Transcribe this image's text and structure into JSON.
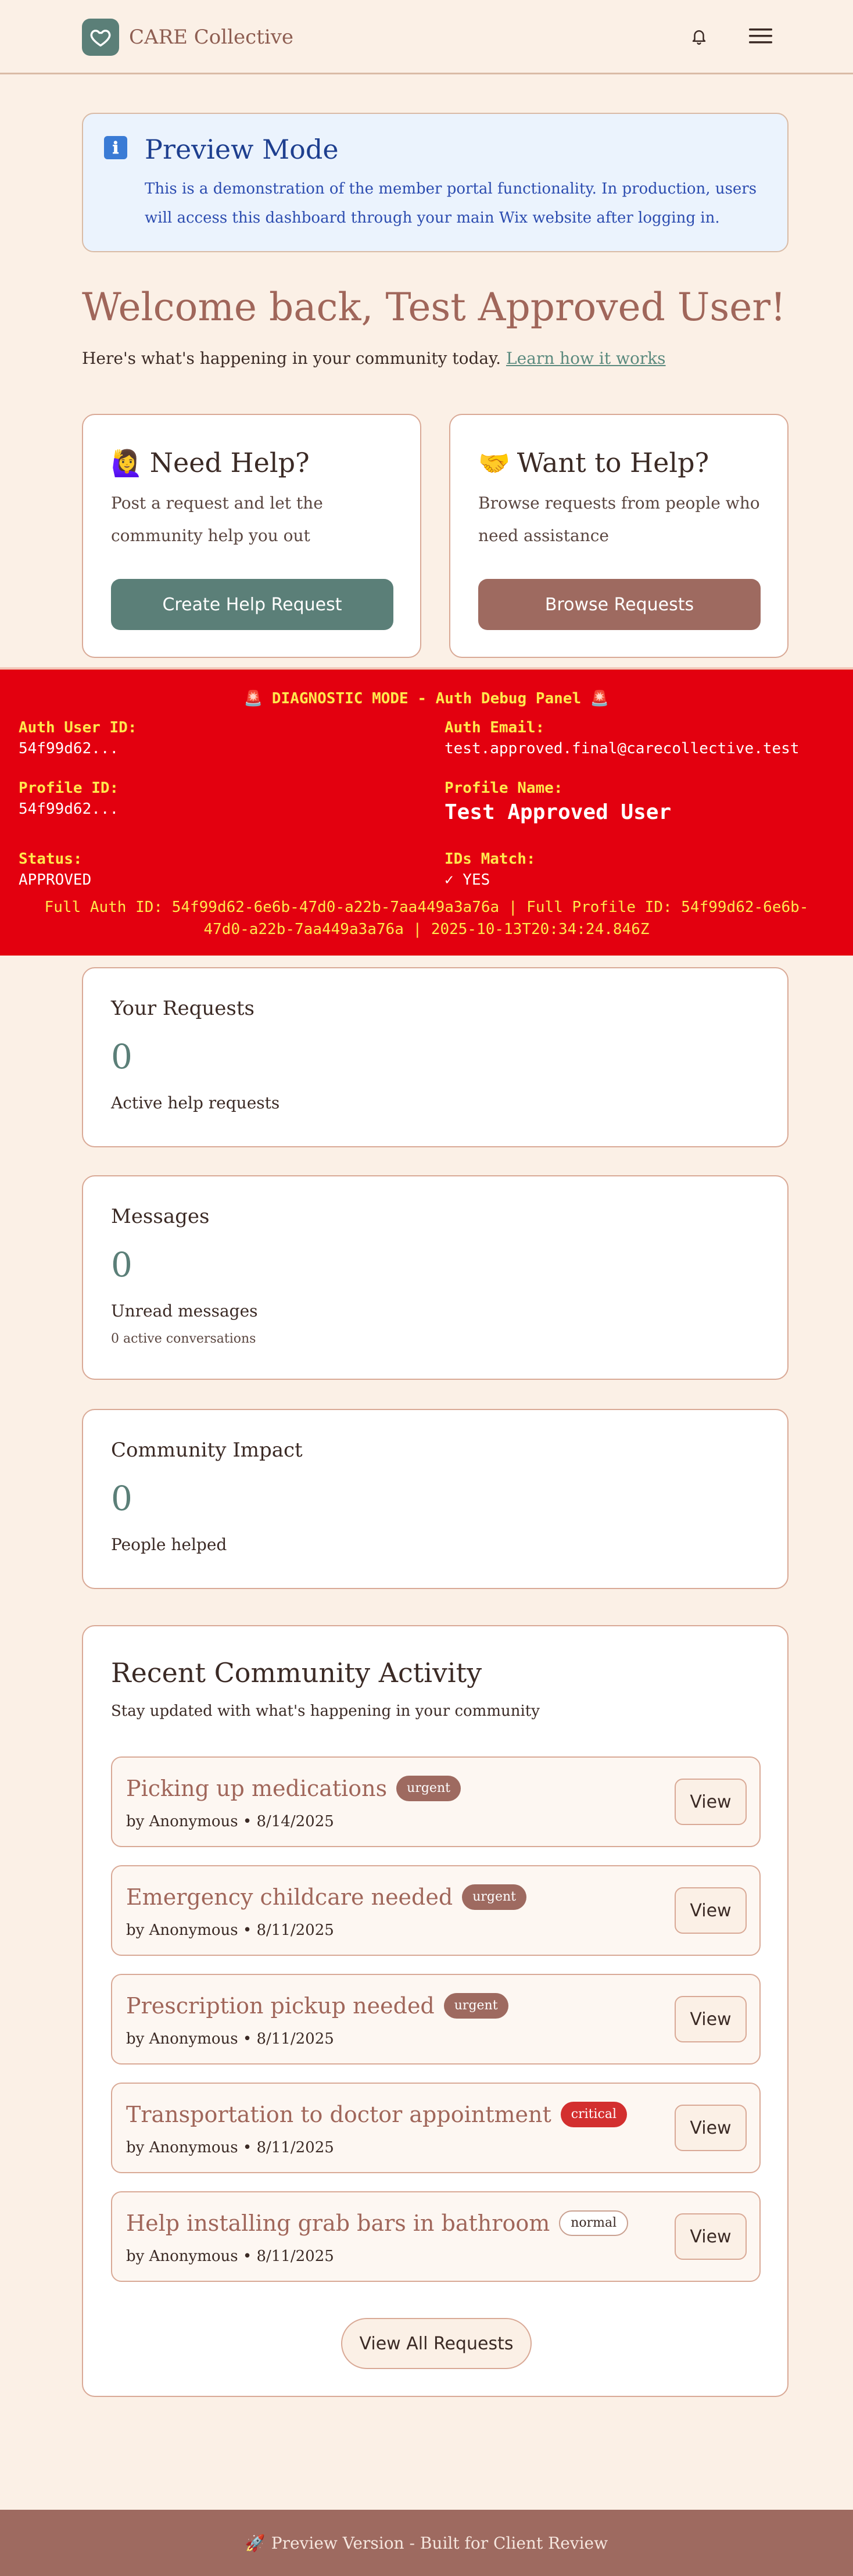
{
  "header": {
    "brand": "CARE Collective",
    "logo_icon": "heart-icon",
    "notifications_icon": "bell-icon",
    "menu_icon": "hamburger-menu-icon"
  },
  "preview": {
    "icon": "ℹ",
    "title": "Preview Mode",
    "text": "This is a demonstration of the member portal functionality. In production, users will access this dashboard through your main Wix website after logging in."
  },
  "welcome": {
    "title": "Welcome back, Test Approved User!",
    "subtitle": "Here's what's happening in your community today.",
    "link": "Learn how it works"
  },
  "need_help": {
    "emoji": "🙋‍♀️",
    "title": "Need Help?",
    "description": "Post a request and let the community help you out",
    "button": "Create Help Request"
  },
  "want_help": {
    "emoji": "🤝",
    "title": "Want to Help?",
    "description": "Browse requests from people who need assistance",
    "button": "Browse Requests"
  },
  "debug": {
    "title": "🚨 DIAGNOSTIC MODE - Auth Debug Panel 🚨",
    "auth_user_id_label": "Auth User ID:",
    "auth_user_id": "54f99d62...",
    "auth_email_label": "Auth Email:",
    "auth_email": "test.approved.final@carecollective.test",
    "profile_id_label": "Profile ID:",
    "profile_id": "54f99d62...",
    "profile_name_label": "Profile Name:",
    "profile_name": "Test Approved User",
    "status_label": "Status:",
    "status": "APPROVED",
    "ids_match_label": "IDs Match:",
    "ids_match": "✓ YES",
    "footer": "Full Auth ID: 54f99d62-6e6b-47d0-a22b-7aa449a3a76a | Full Profile ID: 54f99d62-6e6b-47d0-a22b-7aa449a3a76a | 2025-10-13T20:34:24.846Z"
  },
  "stats": {
    "requests": {
      "title": "Your Requests",
      "value": "0",
      "label": "Active help requests"
    },
    "messages": {
      "title": "Messages",
      "value": "0",
      "label": "Unread messages",
      "sub": "0 active conversations"
    },
    "impact": {
      "title": "Community Impact",
      "value": "0",
      "label": "People helped"
    }
  },
  "activity": {
    "title": "Recent Community Activity",
    "subtitle": "Stay updated with what's happening in your community",
    "view_label": "View",
    "view_all": "View All Requests",
    "items": [
      {
        "title": "Picking up medications",
        "badge": "urgent",
        "meta": "by Anonymous • 8/14/2025"
      },
      {
        "title": "Emergency childcare needed",
        "badge": "urgent",
        "meta": "by Anonymous • 8/11/2025"
      },
      {
        "title": "Prescription pickup needed",
        "badge": "urgent",
        "meta": "by Anonymous • 8/11/2025"
      },
      {
        "title": "Transportation to doctor appointment",
        "badge": "critical",
        "meta": "by Anonymous • 8/11/2025"
      },
      {
        "title": "Help installing grab bars in bathroom",
        "badge": "normal",
        "meta": "by Anonymous • 8/11/2025"
      }
    ]
  },
  "footer": {
    "emoji": "🚀",
    "text": "Preview Version - Built for Client Review"
  },
  "colors": {
    "background": "#FBF0E6",
    "sage": "#5B7F78",
    "terracotta": "#9E6A60",
    "debug_red": "#E3000F",
    "critical": "#D32F2F"
  }
}
